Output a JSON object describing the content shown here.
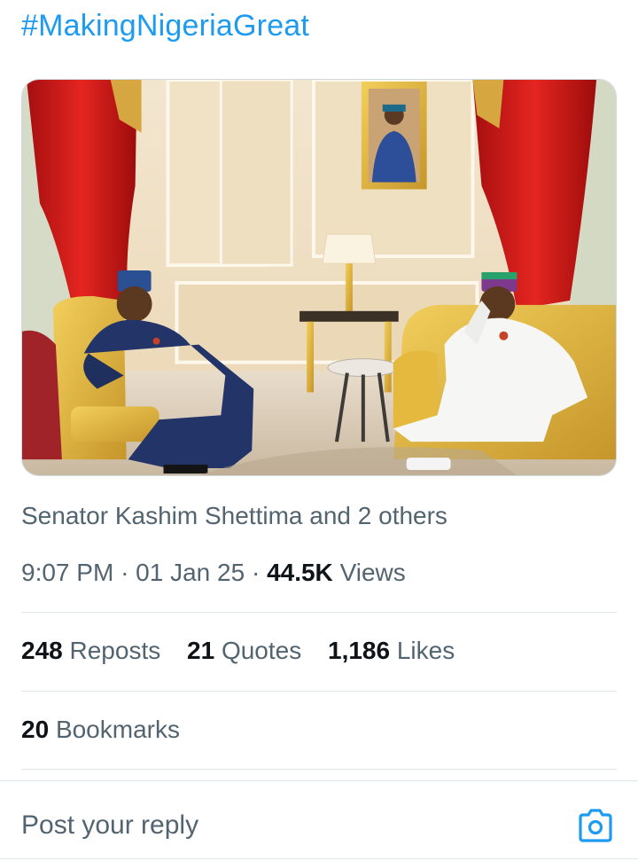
{
  "post": {
    "hashtag": "#MakingNigeriaGreat",
    "tagged_text": "Senator Kashim Shettima and 2 others",
    "time": "9:07 PM",
    "sep": "·",
    "date": "01 Jan 25",
    "views_count": "44.5K",
    "views_label": "Views"
  },
  "stats": {
    "reposts_count": "248",
    "reposts_label": "Reposts",
    "quotes_count": "21",
    "quotes_label": "Quotes",
    "likes_count": "1,186",
    "likes_label": "Likes",
    "bookmarks_count": "20",
    "bookmarks_label": "Bookmarks"
  },
  "reply": {
    "placeholder": "Post your reply"
  },
  "icons": {
    "media": "camera-icon"
  },
  "colors": {
    "accent": "#1d9bf0",
    "secondary_text": "#536471",
    "primary_text": "#0f1419"
  }
}
